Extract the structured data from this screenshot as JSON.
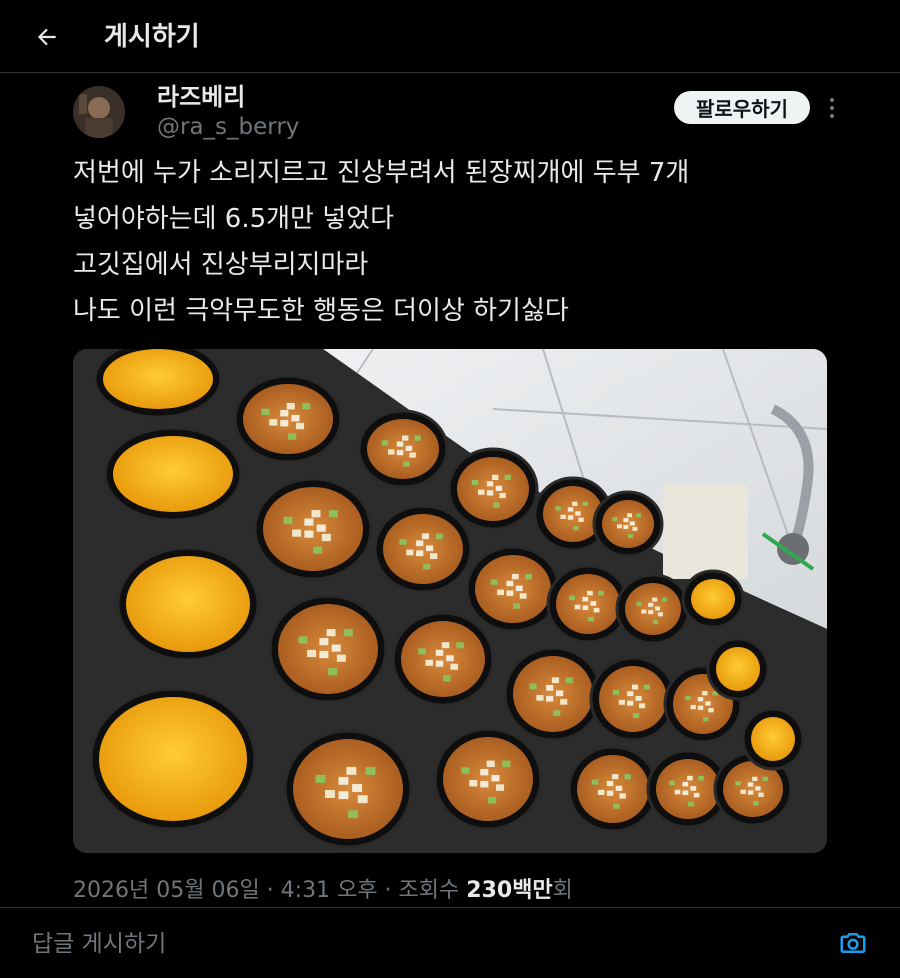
{
  "header": {
    "title": "게시하기",
    "back_icon": "back-arrow-icon"
  },
  "author": {
    "display_name": "라즈베리",
    "handle": "@ra_s_berry",
    "avatar": "avatar"
  },
  "actions": {
    "follow_label": "팔로우하기",
    "more_icon": "more-dots-icon"
  },
  "tweet": {
    "lines": [
      "저번에 누가 소리지르고 진상부려서 된장찌개에 두부 7개",
      "넣어야하는데 6.5개만 넣었다",
      "고깃집에서 진상부리지마라",
      "나도 이런 극악무도한 행동은 더이상 하기싫다"
    ]
  },
  "photo": {
    "subject": "rows of clay pots of doenjang-jjigae and steamed egg on a stove"
  },
  "meta": {
    "date": "2026년 05월 06일",
    "sep1": " · ",
    "time": "4:31 오후",
    "sep2": " · ",
    "views_label": "조회수 ",
    "views_value": "230백만",
    "views_suffix": "회"
  },
  "reply": {
    "placeholder": "답글 게시하기",
    "camera_icon": "camera-icon"
  },
  "colors": {
    "background": "#000000",
    "text": "#e7e9ea",
    "secondary": "#71767b",
    "accent": "#1d9bf0",
    "divider": "#2f3336"
  }
}
